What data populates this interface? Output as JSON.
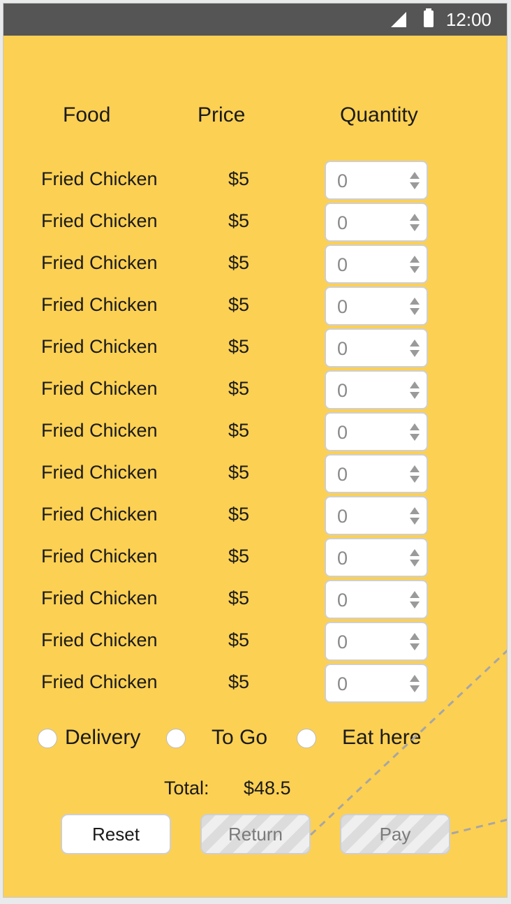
{
  "statusbar": {
    "time": "12:00",
    "icons": [
      "signal-icon",
      "battery-icon"
    ],
    "background": "#555555"
  },
  "theme": {
    "background": "#fcd053"
  },
  "headers": {
    "food": "Food",
    "price": "Price",
    "quantity": "Quantity"
  },
  "items": [
    {
      "name": "Fried Chicken",
      "price": "$5",
      "quantity": "0"
    },
    {
      "name": "Fried Chicken",
      "price": "$5",
      "quantity": "0"
    },
    {
      "name": "Fried Chicken",
      "price": "$5",
      "quantity": "0"
    },
    {
      "name": "Fried Chicken",
      "price": "$5",
      "quantity": "0"
    },
    {
      "name": "Fried Chicken",
      "price": "$5",
      "quantity": "0"
    },
    {
      "name": "Fried Chicken",
      "price": "$5",
      "quantity": "0"
    },
    {
      "name": "Fried Chicken",
      "price": "$5",
      "quantity": "0"
    },
    {
      "name": "Fried Chicken",
      "price": "$5",
      "quantity": "0"
    },
    {
      "name": "Fried Chicken",
      "price": "$5",
      "quantity": "0"
    },
    {
      "name": "Fried Chicken",
      "price": "$5",
      "quantity": "0"
    },
    {
      "name": "Fried Chicken",
      "price": "$5",
      "quantity": "0"
    },
    {
      "name": "Fried Chicken",
      "price": "$5",
      "quantity": "0"
    },
    {
      "name": "Fried Chicken",
      "price": "$5",
      "quantity": "0"
    }
  ],
  "order_type": {
    "options": [
      {
        "label": "Delivery",
        "selected": false
      },
      {
        "label": "To Go",
        "selected": false
      },
      {
        "label": "Eat here",
        "selected": false
      }
    ]
  },
  "total": {
    "label": "Total:",
    "value": "$48.5"
  },
  "buttons": {
    "reset": "Reset",
    "return": "Return",
    "pay": "Pay",
    "return_disabled": true,
    "pay_disabled": true
  }
}
